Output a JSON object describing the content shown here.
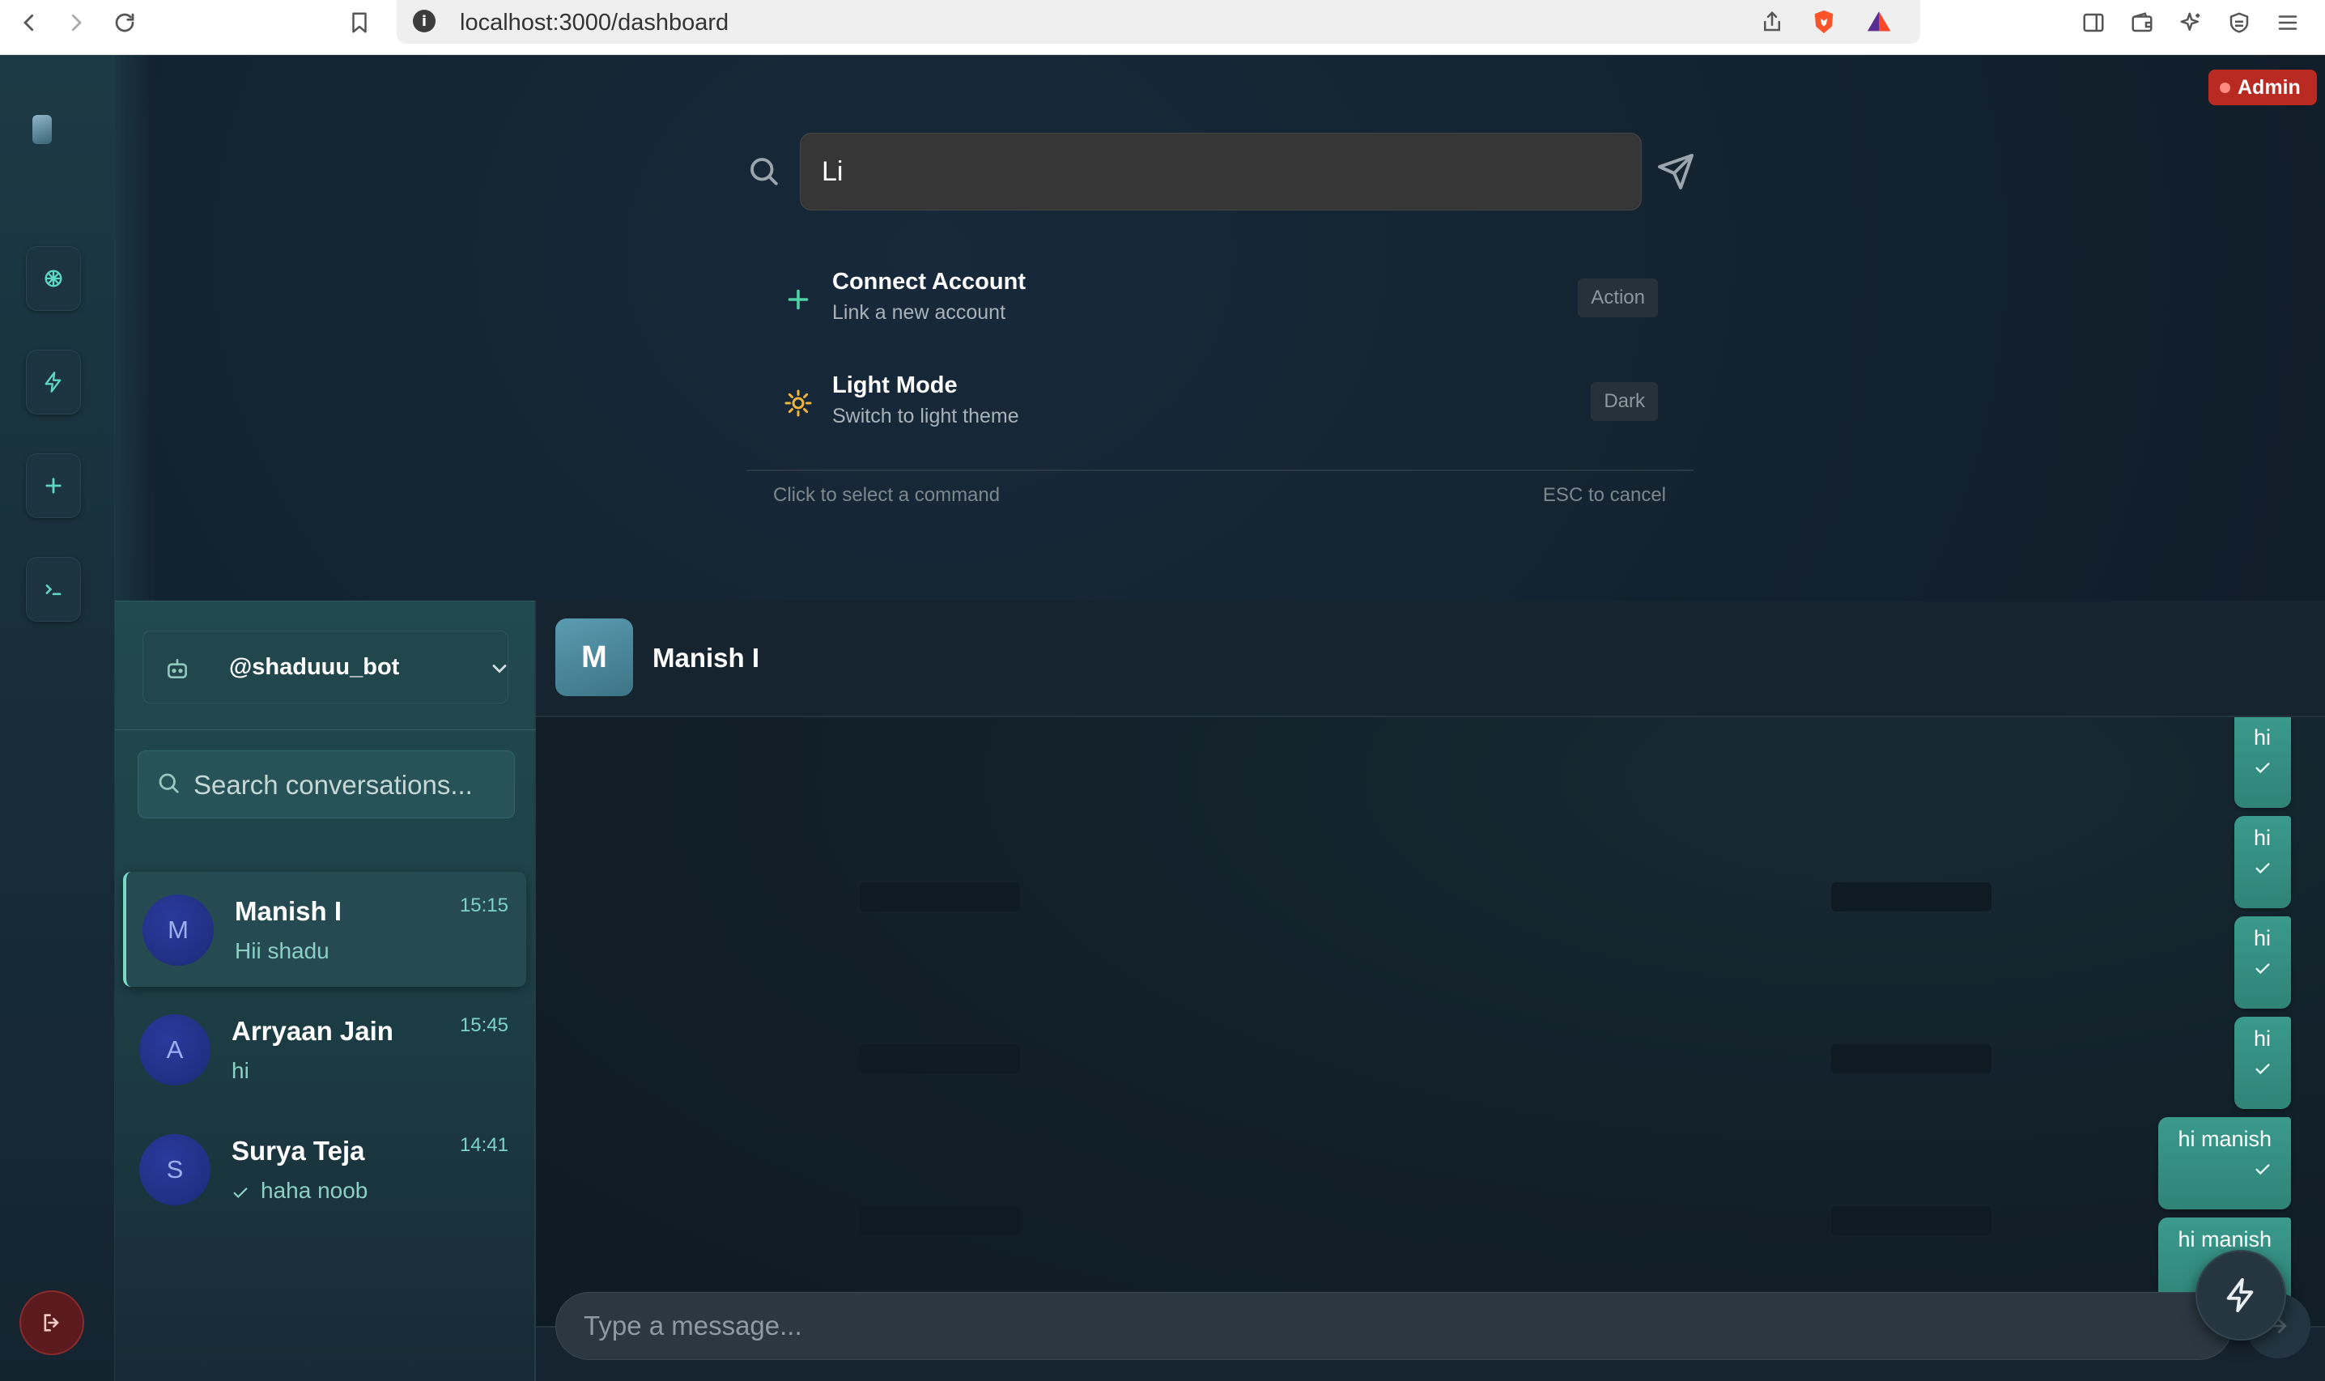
{
  "browser": {
    "url": "localhost:3000/dashboard",
    "info_glyph": "i"
  },
  "badge": {
    "admin": "Admin"
  },
  "command_palette": {
    "query": "Li",
    "items": [
      {
        "title": "Connect Account",
        "subtitle": "Link a new account",
        "tag": "Action",
        "icon": "plus-icon"
      },
      {
        "title": "Light Mode",
        "subtitle": "Switch to light theme",
        "tag": "Dark",
        "icon": "sun-icon"
      }
    ],
    "footer_left": "Click to select a command",
    "footer_right": "ESC to cancel"
  },
  "sidebar": {
    "bot_name": "@shaduuu_bot",
    "search_placeholder": "Search conversations...",
    "conversations": [
      {
        "initial": "M",
        "name": "Manish I",
        "preview": "Hii shadu",
        "time": "15:15",
        "active": true
      },
      {
        "initial": "A",
        "name": "Arryaan Jain",
        "preview": "hi",
        "time": "15:45"
      },
      {
        "initial": "S",
        "name": "Surya Teja",
        "preview": "haha noob",
        "time": "14:41",
        "read_check": true
      }
    ]
  },
  "chat": {
    "contact_initial": "M",
    "contact_name": "Manish I",
    "messages": [
      {
        "text": "hi",
        "status": "sent"
      },
      {
        "text": "hi",
        "status": "sent"
      },
      {
        "text": "hi",
        "status": "sent"
      },
      {
        "text": "hi",
        "status": "sent"
      },
      {
        "text": "hi manish",
        "status": "sent"
      },
      {
        "text": "hi manish",
        "status": "sent"
      }
    ],
    "input_placeholder": "Type a message..."
  },
  "colors": {
    "accent": "#5ed6c4",
    "bubble": "#3a9a8c",
    "admin_badge": "#b92a22",
    "avatar": "#24338a"
  }
}
